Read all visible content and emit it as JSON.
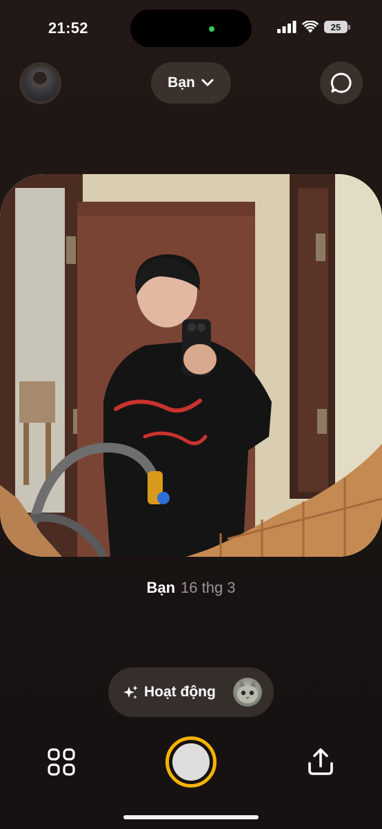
{
  "status_bar": {
    "time": "21:52",
    "battery": "25",
    "icons": [
      "cellular-signal-icon",
      "wifi-icon",
      "battery-icon"
    ]
  },
  "top_bar": {
    "friend_selector_label": "Bạn",
    "left_icon": "profile-avatar",
    "right_icon": "chat-bubble-icon"
  },
  "post": {
    "author": "Bạn",
    "date": "16 thg 3"
  },
  "activity": {
    "label": "Hoạt động",
    "icon": "sparkles-icon"
  },
  "bottom_bar": {
    "left_icon": "grid-icon",
    "center": "shutter-button",
    "right_icon": "share-icon"
  },
  "colors": {
    "background": "#1d1614",
    "pill": "#3a302c",
    "shutter_ring": "#f5b301",
    "muted_text": "#9c9492",
    "online_dot": "#34c759"
  }
}
